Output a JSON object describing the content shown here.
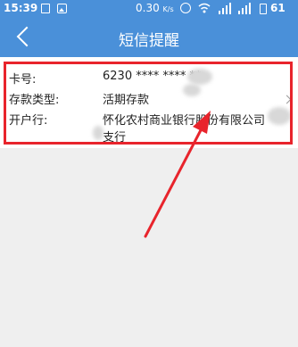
{
  "status_bar": {
    "time": "15:39",
    "speed": "0.30",
    "speed_unit": "K/s",
    "battery": "61"
  },
  "title_bar": {
    "title": "短信提醒"
  },
  "account": {
    "card_label": "卡号:",
    "card_value": "6230 **** **** **",
    "type_label": "存款类型:",
    "type_value": "活期存款",
    "bank_label": "开户行:",
    "bank_value_line1": "怀化农村商业银行股份有限公司",
    "bank_value_line2": "支行"
  },
  "colors": {
    "header": "#4a90d9",
    "highlight": "#e8242c",
    "background": "#efefef"
  }
}
